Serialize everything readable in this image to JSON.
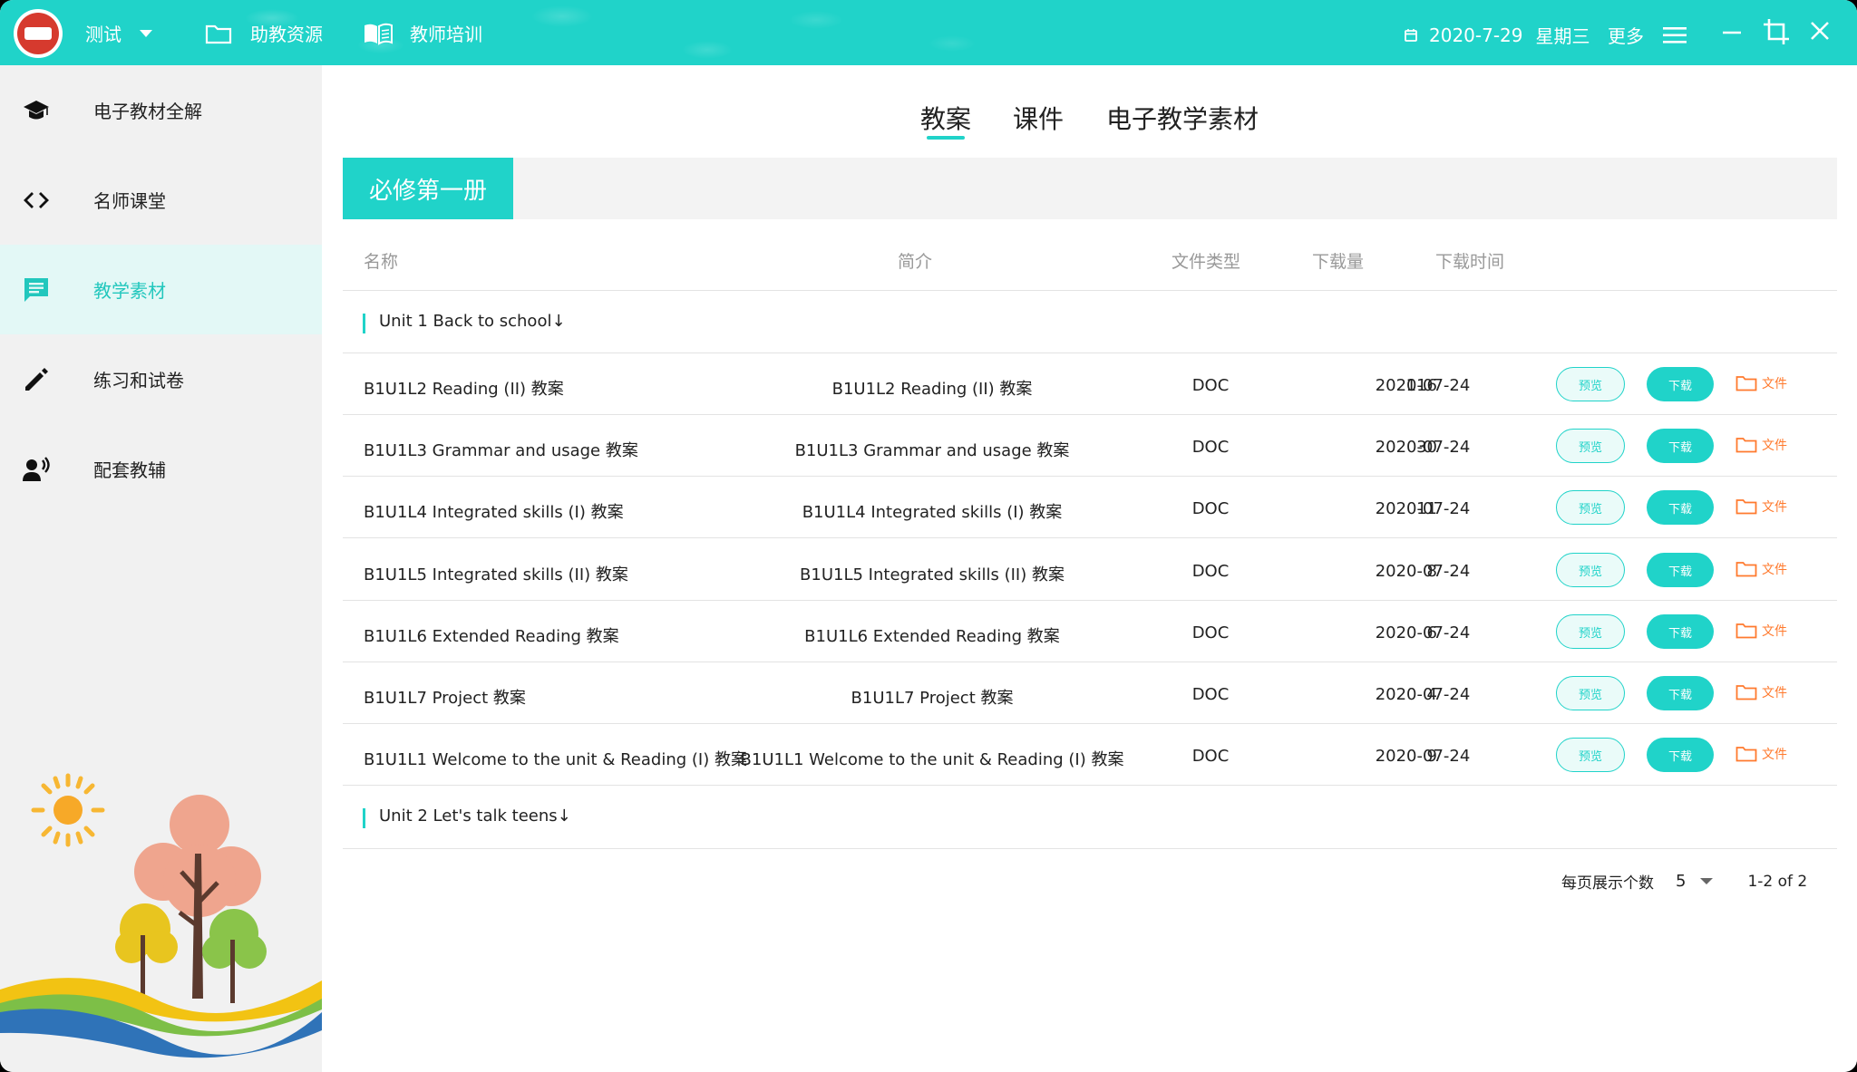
{
  "topbar": {
    "user_label": "测试",
    "nav_items": [
      {
        "label": "助教资源",
        "icon": "folder-icon"
      },
      {
        "label": "教师培训",
        "icon": "book-icon"
      }
    ],
    "date": "2020-7-29",
    "weekday": "星期三",
    "more_label": "更多"
  },
  "sidebar": {
    "items": [
      {
        "label": "电子教材全解",
        "icon": "graduation-cap-icon",
        "active": false
      },
      {
        "label": "名师课堂",
        "icon": "code-icon",
        "active": false
      },
      {
        "label": "教学素材",
        "icon": "message-icon",
        "active": true
      },
      {
        "label": "练习和试卷",
        "icon": "pencil-icon",
        "active": false
      },
      {
        "label": "配套教辅",
        "icon": "speaker-person-icon",
        "active": false
      }
    ]
  },
  "tabs": [
    {
      "label": "教案",
      "active": true
    },
    {
      "label": "课件",
      "active": false
    },
    {
      "label": "电子教学素材",
      "active": false
    }
  ],
  "section_title": "必修第一册",
  "table": {
    "columns": [
      "名称",
      "简介",
      "文件类型",
      "下载量",
      "下载时间"
    ],
    "groups": [
      {
        "label": "Unit 1 Back to school↓"
      },
      {
        "label": "Unit 2 Let's talk teens↓"
      }
    ],
    "rows": [
      {
        "name": "B1U1L2 Reading (II) 教案",
        "desc": "B1U1L2 Reading (II) 教案",
        "type": "DOC",
        "downloads": "116",
        "date": "2020-07-24"
      },
      {
        "name": "B1U1L3 Grammar and usage 教案",
        "desc": "B1U1L3 Grammar and usage 教案",
        "type": "DOC",
        "downloads": "30",
        "date": "2020-07-24"
      },
      {
        "name": "B1U1L4 Integrated skills (I) 教案",
        "desc": "B1U1L4 Integrated skills (I) 教案",
        "type": "DOC",
        "downloads": "11",
        "date": "2020-07-24"
      },
      {
        "name": "B1U1L5 Integrated skills (II) 教案",
        "desc": "B1U1L5 Integrated skills (II) 教案",
        "type": "DOC",
        "downloads": "8",
        "date": "2020-07-24"
      },
      {
        "name": "B1U1L6 Extended Reading 教案",
        "desc": "B1U1L6 Extended Reading 教案",
        "type": "DOC",
        "downloads": "6",
        "date": "2020-07-24"
      },
      {
        "name": "B1U1L7 Project 教案",
        "desc": "B1U1L7 Project 教案",
        "type": "DOC",
        "downloads": "4",
        "date": "2020-07-24"
      },
      {
        "name": "B1U1L1 Welcome to the unit & Reading (I) 教案",
        "desc": "B1U1L1 Welcome to the unit & Reading (I) 教案",
        "type": "DOC",
        "downloads": "9",
        "date": "2020-07-24"
      }
    ],
    "row_actions": {
      "preview": "预览",
      "download": "下载",
      "file": "文件"
    }
  },
  "pagination": {
    "per_page_label": "每页展示个数",
    "per_page_value": "5",
    "range": "1-2 of 2"
  },
  "colors": {
    "accent": "#20d3c9",
    "file_link": "#ff7a2e",
    "sidebar_bg": "#f1f1f1"
  }
}
